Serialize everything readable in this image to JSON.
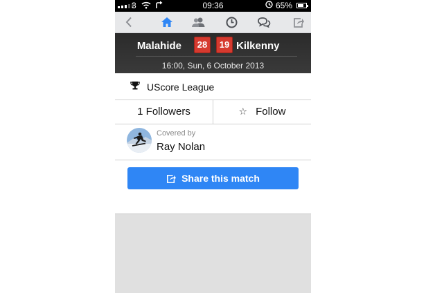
{
  "status_bar": {
    "carrier": "3",
    "time": "09:36",
    "battery": "65%",
    "signal_bars_filled": 3,
    "signal_bars_total": 5
  },
  "nav": {
    "items": [
      {
        "icon": "back-chevron-icon"
      },
      {
        "icon": "home-icon",
        "color": "#2f86f5"
      },
      {
        "icon": "users-icon"
      },
      {
        "icon": "clock-icon"
      },
      {
        "icon": "chat-bubbles-icon"
      },
      {
        "icon": "share-icon"
      }
    ]
  },
  "match": {
    "home_team": "Malahide",
    "home_score": "28",
    "away_score": "19",
    "away_team": "Kilkenny",
    "datetime": "16:00, Sun, 6 October 2013",
    "score_color": "#d63a2f"
  },
  "league": {
    "icon": "trophy-icon",
    "name": "UScore League"
  },
  "followers": {
    "count_label": "1 Followers",
    "follow_label": "Follow",
    "follow_icon": "star-outline-icon"
  },
  "coverage": {
    "label": "Covered by",
    "name": "Ray Nolan"
  },
  "share_button": {
    "label": "Share this match",
    "color": "#2f86f5"
  }
}
